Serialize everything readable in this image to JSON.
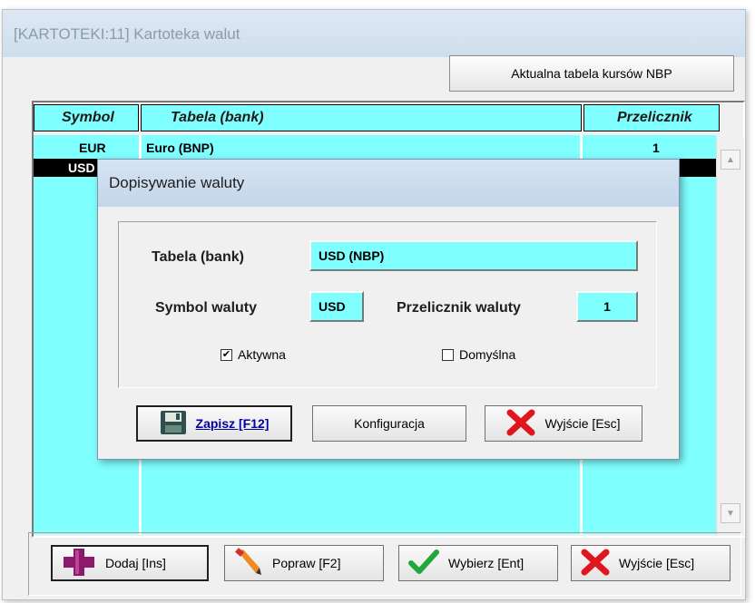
{
  "window": {
    "title": "[KARTOTEKI:11]  Kartoteka walut",
    "nbp_button": "Aktualna tabela  kursów NBP"
  },
  "grid": {
    "headers": [
      "Symbol",
      "Tabela (bank)",
      "Przelicznik"
    ],
    "rows": [
      {
        "symbol": "EUR",
        "tabela": "Euro (BNP)",
        "przelicznik": "1"
      },
      {
        "symbol": "USD",
        "tabela": "",
        "przelicznik": ""
      }
    ],
    "scroll_up": "▲",
    "scroll_down": "▼"
  },
  "buttons": {
    "dodaj": "Dodaj  [Ins]",
    "popraw": "Popraw   [F2]",
    "wybierz": "Wybierz  [Ent]",
    "wyjscie": "Wyjście  [Esc]"
  },
  "dialog": {
    "title": "Dopisywanie waluty",
    "tabela_label": "Tabela (bank)",
    "tabela_value": "USD (NBP)",
    "symbol_label": "Symbol waluty",
    "symbol_value": "USD",
    "przelicznik_label": "Przelicznik waluty",
    "przelicznik_value": "1",
    "aktywna_label": "Aktywna",
    "aktywna_checked": true,
    "domyslna_label": "Domyślna",
    "domyslna_checked": false,
    "zapisz": "Zapisz  [F12]",
    "konfiguracja": "Konfiguracja",
    "wyjscie": "Wyjście  [Esc]"
  },
  "colors": {
    "grid_bg": "#80ffff",
    "selected_row": "#000000",
    "link_blue": "#0000a0"
  }
}
